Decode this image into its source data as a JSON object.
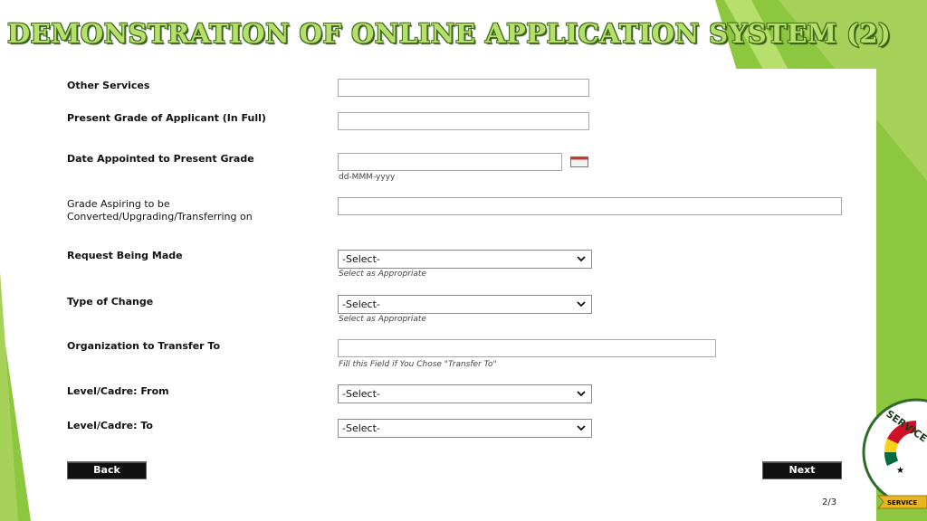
{
  "slide": {
    "title": "DEMONSTRATION OF ONLINE APPLICATION SYSTEM (2)",
    "page_number": "2/3"
  },
  "form": {
    "other_services": {
      "label": "Other Services",
      "value": ""
    },
    "present_grade": {
      "label": "Present Grade of Applicant (In Full)",
      "value": ""
    },
    "date_appointed": {
      "label": "Date Appointed to Present Grade",
      "value": "",
      "format_hint": "dd-MMM-yyyy",
      "icon": "calendar-icon"
    },
    "grade_aspiring": {
      "label": "Grade Aspiring to be Converted/Upgrading/Transferring on",
      "value": ""
    },
    "request_being_made": {
      "label": "Request Being Made",
      "selected": "-Select-",
      "hint": "Select as Appropriate"
    },
    "type_of_change": {
      "label": "Type of Change",
      "selected": "-Select-",
      "hint": "Select as Appropriate"
    },
    "organization_transfer": {
      "label": "Organization to Transfer To",
      "value": "",
      "hint": "Fill this Field if You Chose \"Transfer To\""
    },
    "level_from": {
      "label": "Level/Cadre: From",
      "selected": "-Select-"
    },
    "level_to": {
      "label": "Level/Cadre: To",
      "selected": "-Select-"
    }
  },
  "buttons": {
    "back": "Back",
    "next": "Next"
  },
  "emblem": {
    "text_top": "SERVICE",
    "text_ribbon": "SERVICE"
  },
  "colors": {
    "accent_green": "#8dc63f",
    "dark_green": "#3f6e1a",
    "title_fill": "#b7df6b"
  }
}
